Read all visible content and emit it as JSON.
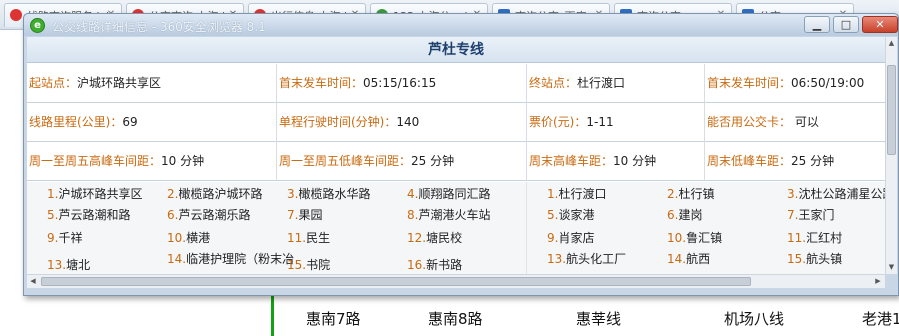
{
  "background_tabs": [
    {
      "label": "线路查询服务 ivi",
      "icon": "red-circle-icon"
    },
    {
      "label": "公交查询 上海 ivi",
      "icon": "red-circle-icon"
    },
    {
      "label": "出行信息 上海 ivi",
      "icon": "red-circle-icon"
    },
    {
      "label": "133 上海公... ivi",
      "icon": "green-circle-icon"
    },
    {
      "label": "查询公交_百度",
      "icon": "blue-square-icon"
    },
    {
      "label": "查询公交",
      "icon": "blue-square-icon"
    },
    {
      "label": "公交",
      "icon": "blue-square-icon"
    }
  ],
  "background_routes": [
    "惠南7路",
    "惠南8路",
    "惠莘线",
    "机场八线",
    "老港1"
  ],
  "window": {
    "title": "公交线路详细信息 - 360安全浏览器 8.1",
    "minimize": "▁",
    "maximize": "□",
    "close": "✕"
  },
  "route": {
    "name": "芦杜专线",
    "info_rows": [
      [
        {
          "label": "起站点：",
          "value": "沪城环路共享区"
        },
        {
          "label": "首末发车时间：",
          "value": "05:15/16:15"
        },
        {
          "label": "终站点：",
          "value": "杜行渡口"
        },
        {
          "label": "首末发车时间：",
          "value": "06:50/19:00"
        }
      ],
      [
        {
          "label": "线路里程(公里)：",
          "value": "69"
        },
        {
          "label": "单程行驶时间(分钟)：",
          "value": "140"
        },
        {
          "label": "票价(元)：",
          "value": "1-11"
        },
        {
          "label": "能否用公交卡：",
          "value": " 可以"
        }
      ],
      [
        {
          "label": "周一至周五高峰车间距：",
          "value": "10 分钟"
        },
        {
          "label": "周一至周五低峰车间距：",
          "value": "25 分钟"
        },
        {
          "label": "周末高峰车距：",
          "value": "10 分钟"
        },
        {
          "label": "周末低峰车距：",
          "value": "25 分钟"
        }
      ]
    ],
    "stations_up": [
      [
        "1.",
        "沪城环路共享区"
      ],
      [
        "2.",
        "橄榄路沪城环路"
      ],
      [
        "3.",
        "橄榄路水华路"
      ],
      [
        "4.",
        "顺翔路同汇路"
      ],
      [
        "5.",
        "芦云路潮和路"
      ],
      [
        "6.",
        "芦云路潮乐路"
      ],
      [
        "7.",
        "果园"
      ],
      [
        "8.",
        "芦潮港火车站"
      ],
      [
        "9.",
        "千祥"
      ],
      [
        "10.",
        "横港"
      ],
      [
        "11.",
        "民生"
      ],
      [
        "12.",
        "塘民校"
      ],
      [
        "13.",
        "塘北"
      ],
      [
        "14.",
        "临港护理院（粉末冶"
      ],
      [
        "15.",
        "书院"
      ],
      [
        "16.",
        "新书路"
      ]
    ],
    "stations_down": [
      [
        "1.",
        "杜行渡口"
      ],
      [
        "2.",
        "杜行镇"
      ],
      [
        "3.",
        "沈杜公路浦星公路"
      ],
      [
        "5.",
        "谈家港"
      ],
      [
        "6.",
        "建岗"
      ],
      [
        "7.",
        "王家门"
      ],
      [
        "9.",
        "肖家店"
      ],
      [
        "10.",
        "鲁汇镇"
      ],
      [
        "11.",
        "汇红村"
      ],
      [
        "13.",
        "航头化工厂"
      ],
      [
        "14.",
        "航西"
      ],
      [
        "15.",
        "航头镇"
      ]
    ]
  }
}
